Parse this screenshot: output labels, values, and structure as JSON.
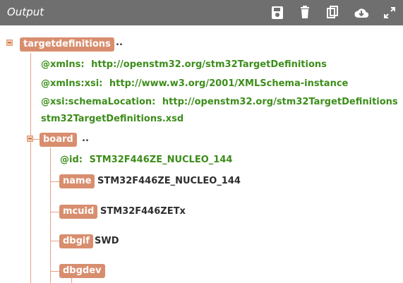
{
  "panel": {
    "title": "Output",
    "toolbar": {
      "save_icon": "save-icon",
      "trash_icon": "trash-icon",
      "copy_icon": "copy-icon",
      "cloud_download_icon": "cloud-download-icon",
      "expand_icon": "expand-icon"
    },
    "colors": {
      "titlebar": "#6f6f6f",
      "tag": "#d88e6e",
      "guide": "#e2a487",
      "attribute": "#3c8d1a",
      "value": "#2d2d2d"
    }
  },
  "tree": {
    "root": {
      "tag": "targetdefinitions",
      "collapsed_marker": "..",
      "attributes": [
        {
          "key": "@xmlns:",
          "value": "http://openstm32.org/stm32TargetDefinitions"
        },
        {
          "key": "@xmlns:xsi:",
          "value": "http://www.w3.org/2001/XMLSchema-instance"
        },
        {
          "key": "@xsi:schemaLocation:",
          "value_line1": "http://openstm32.org/stm32TargetDefinitions",
          "value_line2": "stm32TargetDefinitions.xsd"
        }
      ]
    },
    "board": {
      "tag": "board",
      "collapsed_marker": "..",
      "attribute": {
        "key": "@id:",
        "value": "STM32F446ZE_NUCLEO_144"
      },
      "children": [
        {
          "tag": "name",
          "value": "STM32F446ZE_NUCLEO_144"
        },
        {
          "tag": "mcuid",
          "value": "STM32F446ZETx"
        },
        {
          "tag": "dbgif",
          "value": "SWD"
        },
        {
          "tag": "dbgdev",
          "value": ""
        }
      ]
    }
  }
}
